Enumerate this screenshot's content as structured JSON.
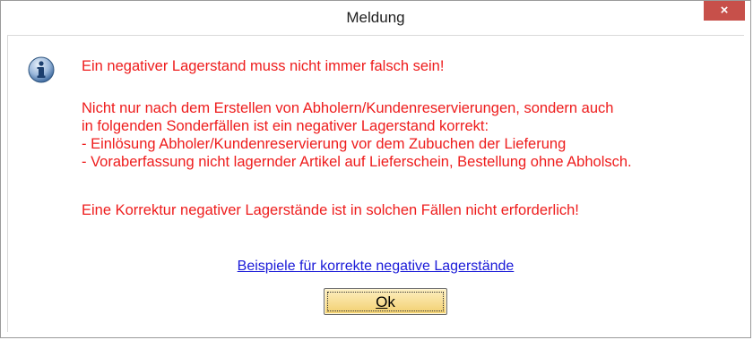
{
  "dialog": {
    "title": "Meldung",
    "close_label": "×",
    "icon": "info-icon",
    "message": {
      "heading": "Ein negativer Lagerstand muss nicht immer falsch sein!",
      "lines": [
        "Nicht nur nach dem Erstellen von Abholern/Kundenreservierungen, sondern auch",
        "in folgenden Sonderfällen ist ein negativer Lagerstand korrekt:",
        "- Einlösung Abholer/Kundenreservierung vor dem Zubuchen der Lieferung",
        "- Voraberfassung nicht lagernder Artikel auf Lieferschein, Bestellung ohne Abholsch."
      ],
      "footer": "Eine Korrektur negativer Lagerstände ist in solchen Fällen nicht erforderlich!"
    },
    "link_text": "Beispiele für korrekte negative Lagerstände",
    "ok_label_first": "O",
    "ok_label_rest": "k"
  },
  "colors": {
    "message_text": "#ee1c1c",
    "link": "#1a1ad8",
    "close_button": "#c7504a",
    "ok_button": "#f2cf6e"
  }
}
